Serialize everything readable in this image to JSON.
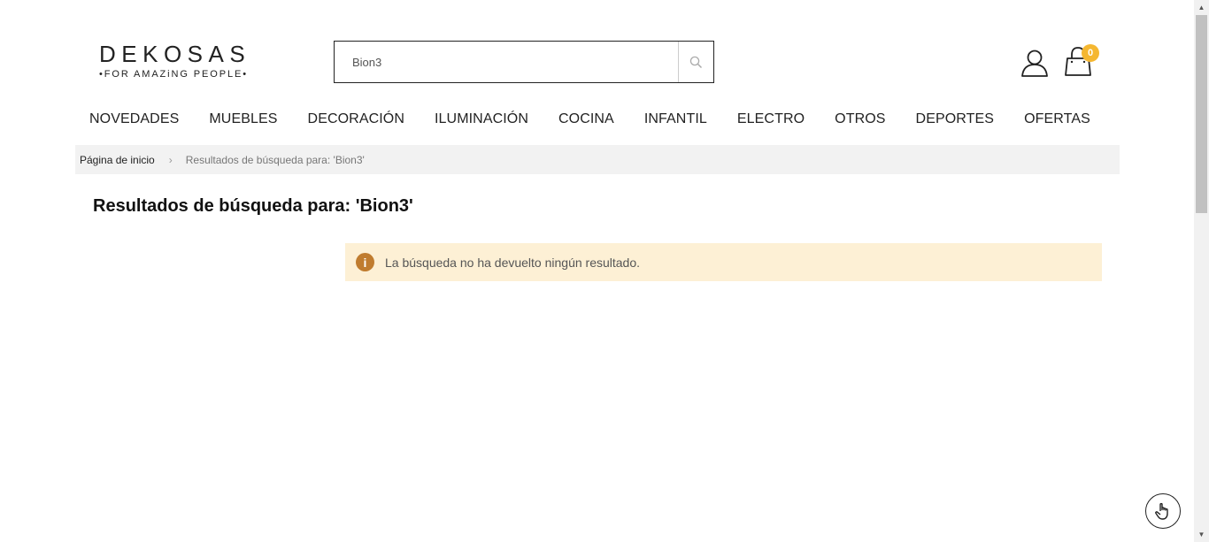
{
  "logo": {
    "main": "DEKOSAS",
    "tagline": "•FOR AMAZiNG PEOPLE•"
  },
  "search": {
    "value": "Bion3",
    "placeholder": ""
  },
  "icons": {
    "search": "search-icon",
    "account": "user-icon",
    "cart": "shopping-bag-icon",
    "info": "info-icon",
    "accessibility": "hand-pointer-icon"
  },
  "cart": {
    "count": "0"
  },
  "nav": {
    "items": [
      {
        "label": "NOVEDADES"
      },
      {
        "label": "MUEBLES"
      },
      {
        "label": "DECORACIÓN"
      },
      {
        "label": "ILUMINACIÓN"
      },
      {
        "label": "COCINA"
      },
      {
        "label": "INFANTIL"
      },
      {
        "label": "ELECTRO"
      },
      {
        "label": "OTROS"
      },
      {
        "label": "DEPORTES"
      },
      {
        "label": "OFERTAS"
      }
    ]
  },
  "breadcrumb": {
    "home": "Página de inicio",
    "separator": "›",
    "current": "Resultados de búsqueda para: 'Bion3'"
  },
  "page": {
    "title": "Resultados de búsqueda para: 'Bion3'"
  },
  "notice": {
    "icon_glyph": "i",
    "text": "La búsqueda no ha devuelto ningún resultado."
  },
  "colors": {
    "notice_bg": "#fdf0d5",
    "notice_icon": "#c07c2f",
    "cart_badge": "#f5b731",
    "breadcrumb_bg": "#f2f2f2"
  }
}
